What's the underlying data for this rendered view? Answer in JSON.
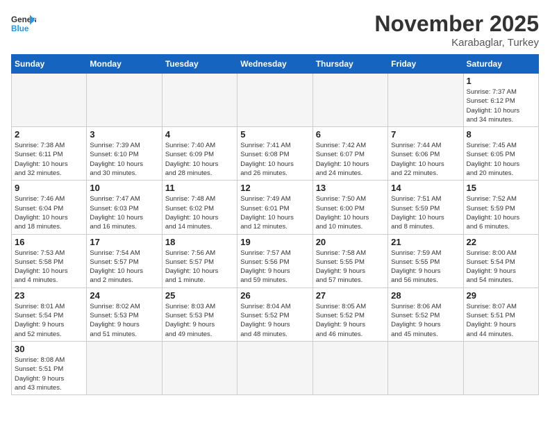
{
  "header": {
    "logo_general": "General",
    "logo_blue": "Blue",
    "month_title": "November 2025",
    "subtitle": "Karabaglar, Turkey"
  },
  "days_of_week": [
    "Sunday",
    "Monday",
    "Tuesday",
    "Wednesday",
    "Thursday",
    "Friday",
    "Saturday"
  ],
  "weeks": [
    [
      {
        "day": "",
        "info": ""
      },
      {
        "day": "",
        "info": ""
      },
      {
        "day": "",
        "info": ""
      },
      {
        "day": "",
        "info": ""
      },
      {
        "day": "",
        "info": ""
      },
      {
        "day": "",
        "info": ""
      },
      {
        "day": "1",
        "info": "Sunrise: 7:37 AM\nSunset: 6:12 PM\nDaylight: 10 hours\nand 34 minutes."
      }
    ],
    [
      {
        "day": "2",
        "info": "Sunrise: 7:38 AM\nSunset: 6:11 PM\nDaylight: 10 hours\nand 32 minutes."
      },
      {
        "day": "3",
        "info": "Sunrise: 7:39 AM\nSunset: 6:10 PM\nDaylight: 10 hours\nand 30 minutes."
      },
      {
        "day": "4",
        "info": "Sunrise: 7:40 AM\nSunset: 6:09 PM\nDaylight: 10 hours\nand 28 minutes."
      },
      {
        "day": "5",
        "info": "Sunrise: 7:41 AM\nSunset: 6:08 PM\nDaylight: 10 hours\nand 26 minutes."
      },
      {
        "day": "6",
        "info": "Sunrise: 7:42 AM\nSunset: 6:07 PM\nDaylight: 10 hours\nand 24 minutes."
      },
      {
        "day": "7",
        "info": "Sunrise: 7:44 AM\nSunset: 6:06 PM\nDaylight: 10 hours\nand 22 minutes."
      },
      {
        "day": "8",
        "info": "Sunrise: 7:45 AM\nSunset: 6:05 PM\nDaylight: 10 hours\nand 20 minutes."
      }
    ],
    [
      {
        "day": "9",
        "info": "Sunrise: 7:46 AM\nSunset: 6:04 PM\nDaylight: 10 hours\nand 18 minutes."
      },
      {
        "day": "10",
        "info": "Sunrise: 7:47 AM\nSunset: 6:03 PM\nDaylight: 10 hours\nand 16 minutes."
      },
      {
        "day": "11",
        "info": "Sunrise: 7:48 AM\nSunset: 6:02 PM\nDaylight: 10 hours\nand 14 minutes."
      },
      {
        "day": "12",
        "info": "Sunrise: 7:49 AM\nSunset: 6:01 PM\nDaylight: 10 hours\nand 12 minutes."
      },
      {
        "day": "13",
        "info": "Sunrise: 7:50 AM\nSunset: 6:00 PM\nDaylight: 10 hours\nand 10 minutes."
      },
      {
        "day": "14",
        "info": "Sunrise: 7:51 AM\nSunset: 5:59 PM\nDaylight: 10 hours\nand 8 minutes."
      },
      {
        "day": "15",
        "info": "Sunrise: 7:52 AM\nSunset: 5:59 PM\nDaylight: 10 hours\nand 6 minutes."
      }
    ],
    [
      {
        "day": "16",
        "info": "Sunrise: 7:53 AM\nSunset: 5:58 PM\nDaylight: 10 hours\nand 4 minutes."
      },
      {
        "day": "17",
        "info": "Sunrise: 7:54 AM\nSunset: 5:57 PM\nDaylight: 10 hours\nand 2 minutes."
      },
      {
        "day": "18",
        "info": "Sunrise: 7:56 AM\nSunset: 5:57 PM\nDaylight: 10 hours\nand 1 minute."
      },
      {
        "day": "19",
        "info": "Sunrise: 7:57 AM\nSunset: 5:56 PM\nDaylight: 9 hours\nand 59 minutes."
      },
      {
        "day": "20",
        "info": "Sunrise: 7:58 AM\nSunset: 5:55 PM\nDaylight: 9 hours\nand 57 minutes."
      },
      {
        "day": "21",
        "info": "Sunrise: 7:59 AM\nSunset: 5:55 PM\nDaylight: 9 hours\nand 56 minutes."
      },
      {
        "day": "22",
        "info": "Sunrise: 8:00 AM\nSunset: 5:54 PM\nDaylight: 9 hours\nand 54 minutes."
      }
    ],
    [
      {
        "day": "23",
        "info": "Sunrise: 8:01 AM\nSunset: 5:54 PM\nDaylight: 9 hours\nand 52 minutes."
      },
      {
        "day": "24",
        "info": "Sunrise: 8:02 AM\nSunset: 5:53 PM\nDaylight: 9 hours\nand 51 minutes."
      },
      {
        "day": "25",
        "info": "Sunrise: 8:03 AM\nSunset: 5:53 PM\nDaylight: 9 hours\nand 49 minutes."
      },
      {
        "day": "26",
        "info": "Sunrise: 8:04 AM\nSunset: 5:52 PM\nDaylight: 9 hours\nand 48 minutes."
      },
      {
        "day": "27",
        "info": "Sunrise: 8:05 AM\nSunset: 5:52 PM\nDaylight: 9 hours\nand 46 minutes."
      },
      {
        "day": "28",
        "info": "Sunrise: 8:06 AM\nSunset: 5:52 PM\nDaylight: 9 hours\nand 45 minutes."
      },
      {
        "day": "29",
        "info": "Sunrise: 8:07 AM\nSunset: 5:51 PM\nDaylight: 9 hours\nand 44 minutes."
      }
    ],
    [
      {
        "day": "30",
        "info": "Sunrise: 8:08 AM\nSunset: 5:51 PM\nDaylight: 9 hours\nand 43 minutes."
      },
      {
        "day": "",
        "info": ""
      },
      {
        "day": "",
        "info": ""
      },
      {
        "day": "",
        "info": ""
      },
      {
        "day": "",
        "info": ""
      },
      {
        "day": "",
        "info": ""
      },
      {
        "day": "",
        "info": ""
      }
    ]
  ]
}
